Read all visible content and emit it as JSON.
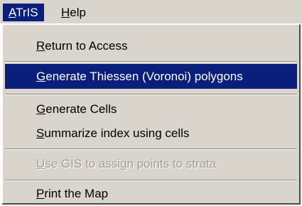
{
  "menubar": {
    "items": [
      {
        "prefix": "",
        "mnemonic": "A",
        "rest": "TrIS",
        "active": true
      },
      {
        "prefix": "",
        "mnemonic": "H",
        "rest": "elp",
        "active": false
      }
    ]
  },
  "dropdown": {
    "items": [
      {
        "mnemonic": "R",
        "rest": "eturn to Access",
        "state": "normal"
      },
      {
        "mnemonic": "G",
        "rest": "enerate Thiessen (Voronoi) polygons",
        "state": "highlighted"
      },
      {
        "mnemonic": "G",
        "rest": "enerate Cells",
        "state": "normal"
      },
      {
        "mnemonic": "S",
        "rest": "ummarize index using cells",
        "state": "normal"
      },
      {
        "mnemonic": "U",
        "rest": "se GIS to assign points to strata",
        "state": "disabled"
      },
      {
        "mnemonic": "P",
        "rest": "rint the Map",
        "state": "normal"
      }
    ]
  },
  "colors": {
    "menu_background": "#d9d4cc",
    "highlight": "#0a1f7c",
    "highlight_text": "#ffffff",
    "disabled_text": "#a19e98"
  }
}
